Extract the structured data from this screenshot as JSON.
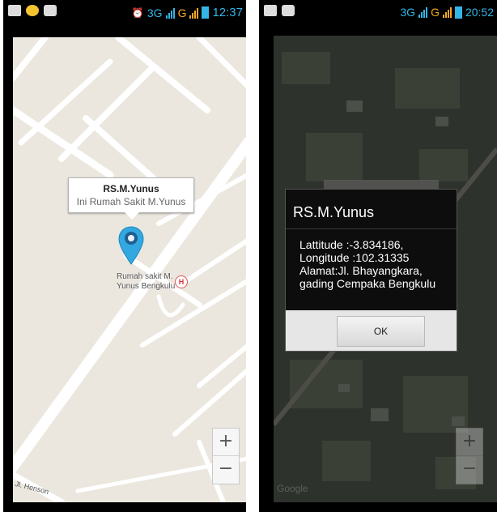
{
  "left_screen": {
    "status": {
      "time": "12:37",
      "network": "3G",
      "network2": "G"
    },
    "marker_info": {
      "title": "RS.M.Yunus",
      "subtitle": "Ini Rumah Sakit M.Yunus"
    },
    "map_label": [
      "Rumah sakit M.",
      "Yunus Bengkulu"
    ],
    "hospital_icon_glyph": "H",
    "street_label": "Jl. Henson",
    "zoom": {
      "in_label": "+",
      "out_label": "−"
    },
    "colors": {
      "map_bg": "#ebe7df",
      "road": "#ffffff",
      "marker": "#33a8e0"
    }
  },
  "right_screen": {
    "status": {
      "time": "20:52",
      "network": "3G",
      "network2": "G"
    },
    "dialog": {
      "title": "RS.M.Yunus",
      "lines": [
        "Lattitude :-3.834186,",
        "Longitude :102.31335",
        "Alamat:Jl. Bhayangkara,",
        "gading Cempaka Bengkulu"
      ],
      "ok_label": "OK"
    },
    "zoom": {
      "in_label": "+",
      "out_label": "−"
    },
    "google_logo": "Google"
  }
}
